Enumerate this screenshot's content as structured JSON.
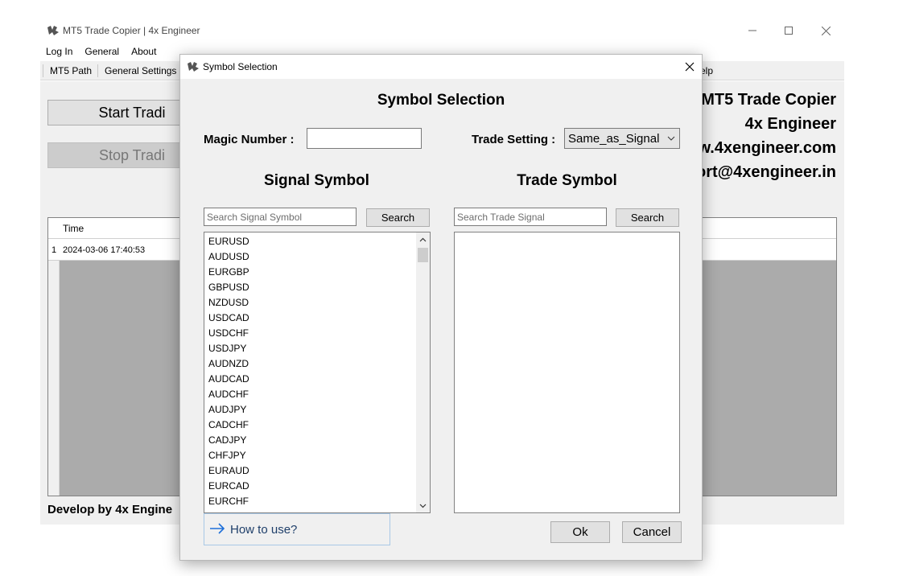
{
  "main_window": {
    "title": "MT5 Trade Copier | 4x Engineer",
    "menu": [
      "Log In",
      "General",
      "About"
    ],
    "toolbar": [
      "MT5 Path",
      "General Settings"
    ],
    "toolbar_right_fragment": "elp",
    "start_label": "Start Tradi",
    "stop_label": "Stop Tradi",
    "brand": {
      "line1": "MT5 Trade Copier",
      "line2": "4x Engineer",
      "line3": "w.4xengineer.com",
      "line4": "ort@4xengineer.in"
    },
    "log": {
      "column_time": "Time",
      "rows": [
        {
          "num": "1",
          "time": "2024-03-06 17:40:53"
        }
      ]
    },
    "footer": "Develop by 4x Engine"
  },
  "dialog": {
    "title": "Symbol Selection",
    "heading": "Symbol Selection",
    "magic_label": "Magic Number :",
    "magic_value": "",
    "trade_setting_label": "Trade Setting :",
    "trade_setting_value": "Same_as_Signal",
    "signal_heading": "Signal Symbol",
    "trade_heading": "Trade Symbol",
    "signal_search_placeholder": "Search Signal Symbol",
    "trade_search_placeholder": "Search Trade Signal",
    "search_label": "Search",
    "signal_symbols": [
      "EURUSD",
      "AUDUSD",
      "EURGBP",
      "GBPUSD",
      "NZDUSD",
      "USDCAD",
      "USDCHF",
      "USDJPY",
      "AUDNZD",
      "AUDCAD",
      "AUDCHF",
      "AUDJPY",
      "CADCHF",
      "CADJPY",
      "CHFJPY",
      "EURAUD",
      "EURCAD",
      "EURCHF"
    ],
    "trade_symbols": [],
    "how_to_use": "How to use?",
    "ok_label": "Ok",
    "cancel_label": "Cancel"
  },
  "colors": {
    "window_bg": "#f0f0f0",
    "button_bg": "#e1e1e1",
    "link_text": "#1f3f6a",
    "arrow_blue": "#1e6fd9"
  }
}
